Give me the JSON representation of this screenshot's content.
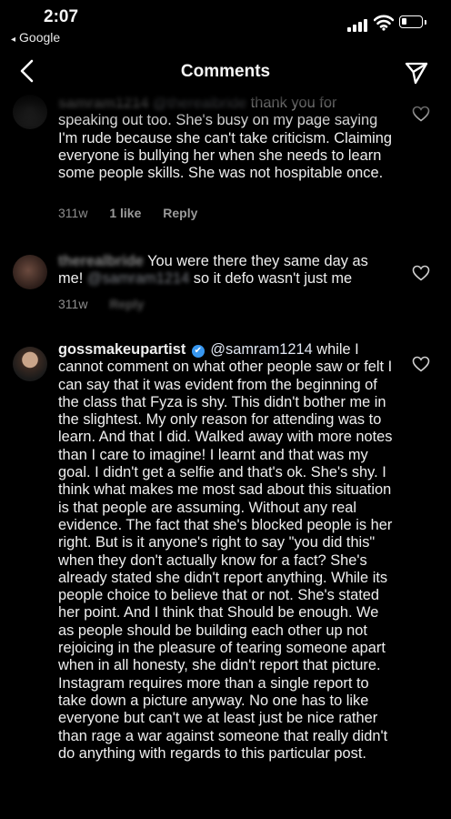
{
  "status_bar": {
    "time": "2:07",
    "back_app": "Google",
    "back_arrow": "◂"
  },
  "header": {
    "title": "Comments",
    "back_icon": "chevron-left-icon",
    "send_icon": "paper-plane-icon"
  },
  "comments": [
    {
      "username": "samram1214",
      "mention": "@therealbride",
      "text": "thank you for speaking out too. She's busy on my page saying I'm rude because she can't take criticism. Claiming everyone is bullying her when she needs to learn some people skills. She was not hospitable once.",
      "time": "311w",
      "likes": "1 like",
      "reply": "Reply"
    },
    {
      "username": "therealbride",
      "text_before": "You were there they same day as me!",
      "mention": "@samram1214",
      "text_after": "so it defo wasn't just me",
      "time": "311w",
      "reply": "Reply"
    },
    {
      "username": "gossmakeupartist",
      "verified": "✔",
      "mention": "@samram1214",
      "text": "while I cannot comment on what other people saw or felt I can say that it was evident from the beginning of the class that Fyza is shy. This didn't bother me in the slightest. My only reason for attending was to learn. And that I did. Walked away with more notes than I care to imagine! I learnt and that was my goal. I didn't get a selfie and that's ok. She's shy. I think what makes me most sad about this situation is that people are assuming. Without any real evidence. The fact that she's blocked people is her right. But is it anyone's right to say \"you did this\" when they don't actually know for a fact? She's already stated she didn't report anything. While its people choice to believe that or not. She's stated her point. And I think that Should be enough. We as people should be building each other up not rejoicing in the pleasure of tearing someone apart when in all honesty, she didn't report that picture. Instagram requires more than a single report to take down a picture anyway. No one has to like everyone but can't we at least just be nice rather than rage a war against someone that really didn't do anything with regards to this particular post."
    }
  ],
  "colors": {
    "background": "#000000",
    "text": "#efefef",
    "meta": "#8e8e8e",
    "verified": "#3897f0"
  }
}
